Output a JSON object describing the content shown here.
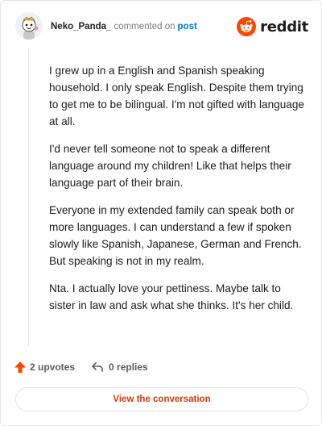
{
  "header": {
    "username": "Neko_Panda_",
    "action_text": "commented on",
    "post_link": "post",
    "brand": "reddit"
  },
  "comment": {
    "paragraphs": [
      "I grew up in a English and Spanish speaking household. I only speak English. Despite them trying to get me to be bilingual. I'm not gifted with language at all.",
      "I'd never tell someone not to speak a different language around my children! Like that helps their language part of their brain.",
      "Everyone in my extended family can speak both or more languages. I can understand a few if spoken slowly like Spanish, Japanese, German and French. But speaking is not in my realm.",
      "Nta. I actually love your pettiness. Maybe talk to sister in law and ask what she thinks. It's her child."
    ]
  },
  "actions": {
    "upvotes": "2 upvotes",
    "replies": "0 replies"
  },
  "footer": {
    "button_label": "View the conversation"
  },
  "colors": {
    "brand_orange": "#ff4500",
    "link_blue": "#0079d3",
    "button_text": "#d93a00"
  },
  "icons": {
    "avatar": "snoo-avatar-icon",
    "brand": "reddit-logo-icon",
    "upvote": "upvote-arrow-icon",
    "reply": "reply-arrow-icon"
  }
}
